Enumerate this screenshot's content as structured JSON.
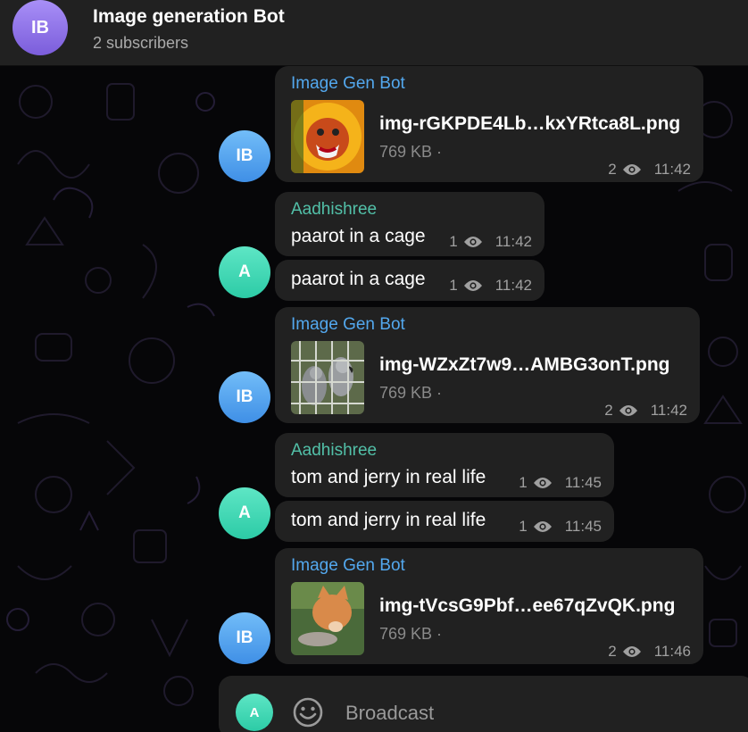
{
  "header": {
    "avatar_initials": "IB",
    "title": "Image generation Bot",
    "subtitle": "2 subscribers"
  },
  "messages": [
    {
      "type": "file",
      "avatar": "IB",
      "sender": "Image Gen Bot",
      "file_name": "img-rGKPDE4Lb…kxYRtca8L.png",
      "file_size": "769 KB ·",
      "views": "2",
      "time": "11:42",
      "thumb": "lion-icon"
    },
    {
      "type": "text",
      "avatar": "A",
      "sender": "Aadhishree",
      "text": "paarot in a cage",
      "views": "1",
      "time": "11:42"
    },
    {
      "type": "text",
      "avatar": "",
      "sender": "",
      "text": "paarot in a cage",
      "views": "1",
      "time": "11:42"
    },
    {
      "type": "file",
      "avatar": "IB",
      "sender": "Image Gen Bot",
      "file_name": "img-WZxZt7w9…AMBG3onT.png",
      "file_size": "769 KB ·",
      "views": "2",
      "time": "11:42",
      "thumb": "parrot-icon"
    },
    {
      "type": "text",
      "avatar": "A",
      "sender": "Aadhishree",
      "text": "tom and jerry in real life",
      "views": "1",
      "time": "11:45"
    },
    {
      "type": "text",
      "avatar": "",
      "sender": "",
      "text": "tom and jerry in real life",
      "views": "1",
      "time": "11:45"
    },
    {
      "type": "file",
      "avatar": "IB",
      "sender": "Image Gen Bot",
      "file_name": "img-tVcsG9Pbf…ee67qZvQK.png",
      "file_size": "769 KB ·",
      "views": "2",
      "time": "11:46",
      "thumb": "cat-icon"
    }
  ],
  "composer": {
    "avatar_initials": "A",
    "placeholder": "Broadcast"
  },
  "colors": {
    "bubble": "#212121",
    "bot_name": "#53a8ee",
    "user_name": "#52c0a8"
  }
}
